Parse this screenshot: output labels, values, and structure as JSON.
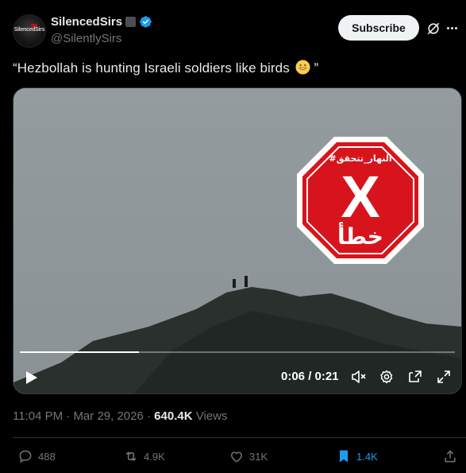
{
  "author": {
    "display_name": "SilencedSirs",
    "handle": "@SilentlySirs",
    "avatar_text": "SilencedSirs",
    "verified": true
  },
  "subscribe_label": "Subscribe",
  "tweet": {
    "text": "“Hezbollah is hunting Israeli soldiers like birds",
    "emoji": "grinning-face",
    "closing_quote": "”"
  },
  "video": {
    "current_time": "0:06",
    "duration": "0:21",
    "time_display": "0:06 / 0:21",
    "progress_fraction": 0.273,
    "overlay": {
      "top_text": "#النهار_تتحقق",
      "mark": "X",
      "verdict": "خطأ",
      "color": "#d7141c"
    }
  },
  "meta": {
    "time": "11:04 PM",
    "separator": "·",
    "date": "Mar 29, 2026",
    "dot": "·",
    "views_count": "640.4K",
    "views_label": "Views"
  },
  "actions": {
    "replies": "488",
    "reposts": "4.9K",
    "likes": "31K",
    "bookmarks": "1.4K"
  },
  "colors": {
    "background": "#000000",
    "accent": "#1d9bf0",
    "muted": "#71767b",
    "text": "#e7e9ea"
  }
}
